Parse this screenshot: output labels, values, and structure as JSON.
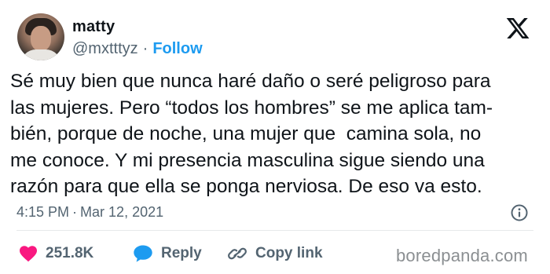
{
  "user": {
    "display_name": "matty",
    "handle": "@mxtttyz",
    "separator": "·",
    "follow_label": "Follow"
  },
  "tweet": {
    "lines": [
      "Sé muy bien que nunca haré daño o seré peligroso para",
      "las mujeres. Pero “todos los hombres” se me aplica tam-",
      "bién, porque de noche, una mujer que  camina sola, no",
      "me conoce. Y mi presencia masculina sigue siendo una",
      "razón para que ella se ponga nerviosa. De eso va esto."
    ],
    "time": "4:15 PM",
    "separator": "·",
    "date": "Mar 12, 2021"
  },
  "actions": {
    "like_count": "251.8K",
    "reply_label": "Reply",
    "copy_link_label": "Copy link"
  },
  "watermark": "boredpanda.com",
  "icons": {
    "brand": "x-logo-icon",
    "info": "info-icon",
    "like": "heart-icon",
    "reply": "speech-bubble-icon",
    "copy": "link-icon"
  },
  "colors": {
    "text": "#0f1419",
    "muted": "#536471",
    "accent": "#1d9bf0",
    "like": "#f91880",
    "divider": "#e7e9ea"
  }
}
